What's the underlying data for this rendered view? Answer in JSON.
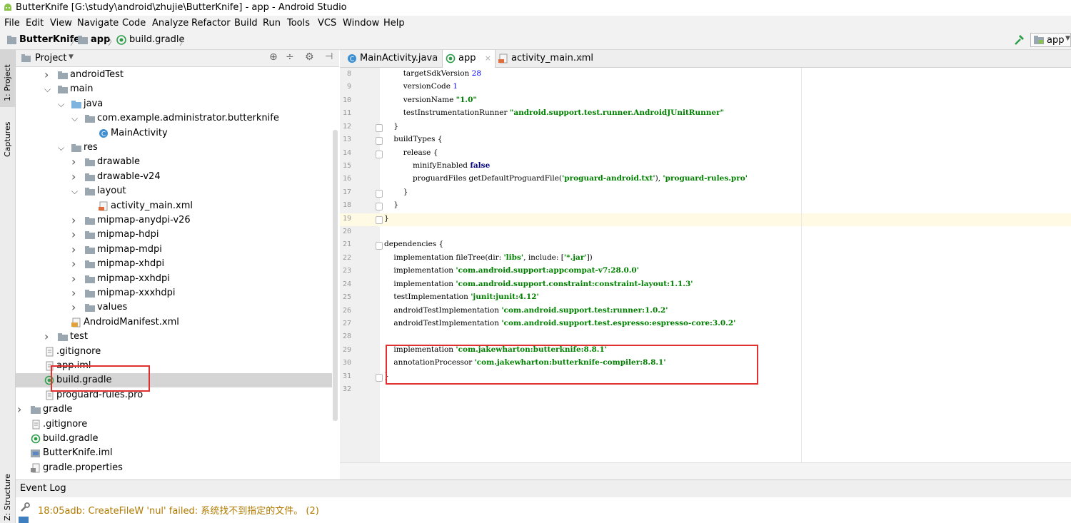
{
  "window": {
    "title": "ButterKnife [G:\\study\\android\\zhujie\\ButterKnife] - app - Android Studio"
  },
  "menu": [
    "File",
    "Edit",
    "View",
    "Navigate",
    "Code",
    "Analyze",
    "Refactor",
    "Build",
    "Run",
    "Tools",
    "VCS",
    "Window",
    "Help"
  ],
  "breadcrumb": {
    "project": "ButterKnife",
    "module": "app",
    "file": "build.gradle"
  },
  "run_config": {
    "label": "app"
  },
  "side_tabs": {
    "project": "1: Project",
    "captures": "Captures",
    "structure": "Z: Structure"
  },
  "project_panel": {
    "title": "Project",
    "tree": [
      {
        "label": "androidTest",
        "depth": 3,
        "arrow": "right",
        "icon": "folder"
      },
      {
        "label": "main",
        "depth": 3,
        "arrow": "down",
        "icon": "folder"
      },
      {
        "label": "java",
        "depth": 4,
        "arrow": "down",
        "icon": "folder-blue"
      },
      {
        "label": "com.example.administrator.butterknife",
        "depth": 5,
        "arrow": "down",
        "icon": "folder"
      },
      {
        "label": "MainActivity",
        "depth": 6,
        "arrow": "",
        "icon": "class"
      },
      {
        "label": "res",
        "depth": 4,
        "arrow": "down",
        "icon": "folder"
      },
      {
        "label": "drawable",
        "depth": 5,
        "arrow": "right",
        "icon": "folder"
      },
      {
        "label": "drawable-v24",
        "depth": 5,
        "arrow": "right",
        "icon": "folder"
      },
      {
        "label": "layout",
        "depth": 5,
        "arrow": "down",
        "icon": "folder"
      },
      {
        "label": "activity_main.xml",
        "depth": 6,
        "arrow": "",
        "icon": "xml"
      },
      {
        "label": "mipmap-anydpi-v26",
        "depth": 5,
        "arrow": "right",
        "icon": "folder"
      },
      {
        "label": "mipmap-hdpi",
        "depth": 5,
        "arrow": "right",
        "icon": "folder"
      },
      {
        "label": "mipmap-mdpi",
        "depth": 5,
        "arrow": "right",
        "icon": "folder"
      },
      {
        "label": "mipmap-xhdpi",
        "depth": 5,
        "arrow": "right",
        "icon": "folder"
      },
      {
        "label": "mipmap-xxhdpi",
        "depth": 5,
        "arrow": "right",
        "icon": "folder"
      },
      {
        "label": "mipmap-xxxhdpi",
        "depth": 5,
        "arrow": "right",
        "icon": "folder"
      },
      {
        "label": "values",
        "depth": 5,
        "arrow": "right",
        "icon": "folder"
      },
      {
        "label": "AndroidManifest.xml",
        "depth": 4,
        "arrow": "",
        "icon": "manifest"
      },
      {
        "label": "test",
        "depth": 3,
        "arrow": "right",
        "icon": "folder"
      },
      {
        "label": ".gitignore",
        "depth": 2,
        "arrow": "",
        "icon": "file"
      },
      {
        "label": "app.iml",
        "depth": 2,
        "arrow": "",
        "icon": "file"
      },
      {
        "label": "build.gradle",
        "depth": 2,
        "arrow": "",
        "icon": "gradle",
        "selected": true
      },
      {
        "label": "proguard-rules.pro",
        "depth": 2,
        "arrow": "",
        "icon": "file"
      },
      {
        "label": "gradle",
        "depth": 1,
        "arrow": "right",
        "icon": "folder"
      },
      {
        "label": ".gitignore",
        "depth": 1,
        "arrow": "",
        "icon": "file"
      },
      {
        "label": "build.gradle",
        "depth": 1,
        "arrow": "",
        "icon": "gradle"
      },
      {
        "label": "ButterKnife.iml",
        "depth": 1,
        "arrow": "",
        "icon": "iml"
      },
      {
        "label": "gradle.properties",
        "depth": 1,
        "arrow": "",
        "icon": "props"
      }
    ]
  },
  "editor_tabs": [
    {
      "label": "MainActivity.java",
      "icon": "class"
    },
    {
      "label": "app",
      "icon": "gradle",
      "active": true
    },
    {
      "label": "activity_main.xml",
      "icon": "xml"
    }
  ],
  "code_lines": [
    {
      "n": "8",
      "t": [
        [
          "        targetSdkVersion ",
          ""
        ],
        [
          "28",
          "num"
        ]
      ]
    },
    {
      "n": "9",
      "t": [
        [
          "        versionCode ",
          ""
        ],
        [
          "1",
          "num"
        ]
      ]
    },
    {
      "n": "10",
      "t": [
        [
          "        versionName ",
          ""
        ],
        [
          "\"1.0\"",
          "str"
        ]
      ]
    },
    {
      "n": "11",
      "t": [
        [
          "        testInstrumentationRunner ",
          ""
        ],
        [
          "\"android.support.test.runner.AndroidJUnitRunner\"",
          "str"
        ]
      ]
    },
    {
      "n": "12",
      "t": [
        [
          "    }",
          ""
        ]
      ]
    },
    {
      "n": "13",
      "t": [
        [
          "    buildTypes {",
          ""
        ]
      ]
    },
    {
      "n": "14",
      "t": [
        [
          "        release {",
          ""
        ]
      ]
    },
    {
      "n": "15",
      "t": [
        [
          "            minifyEnabled ",
          ""
        ],
        [
          "false",
          "kw"
        ]
      ]
    },
    {
      "n": "16",
      "t": [
        [
          "            proguardFiles getDefaultProguardFile(",
          ""
        ],
        [
          "'proguard-android.txt'",
          "str"
        ],
        [
          "), ",
          ""
        ],
        [
          "'proguard-rules.pro'",
          "str"
        ]
      ]
    },
    {
      "n": "17",
      "t": [
        [
          "        }",
          ""
        ]
      ]
    },
    {
      "n": "18",
      "t": [
        [
          "    }",
          ""
        ]
      ]
    },
    {
      "n": "19",
      "t": [
        [
          "}",
          ""
        ]
      ]
    },
    {
      "n": "20",
      "t": [
        [
          "",
          ""
        ]
      ]
    },
    {
      "n": "21",
      "t": [
        [
          "dependencies {",
          ""
        ]
      ]
    },
    {
      "n": "22",
      "t": [
        [
          "    implementation fileTree(dir: ",
          ""
        ],
        [
          "'libs'",
          "str"
        ],
        [
          ", include: [",
          ""
        ],
        [
          "'*.jar'",
          "str"
        ],
        [
          "])",
          ""
        ]
      ]
    },
    {
      "n": "23",
      "t": [
        [
          "    implementation ",
          ""
        ],
        [
          "'com.android.support:appcompat-v7:28.0.0'",
          "str"
        ]
      ]
    },
    {
      "n": "24",
      "t": [
        [
          "    implementation ",
          ""
        ],
        [
          "'com.android.support.constraint:constraint-layout:1.1.3'",
          "str"
        ]
      ]
    },
    {
      "n": "25",
      "t": [
        [
          "    testImplementation ",
          ""
        ],
        [
          "'junit:junit:4.12'",
          "str"
        ]
      ]
    },
    {
      "n": "26",
      "t": [
        [
          "    androidTestImplementation ",
          ""
        ],
        [
          "'com.android.support.test:runner:1.0.2'",
          "str"
        ]
      ]
    },
    {
      "n": "27",
      "t": [
        [
          "    androidTestImplementation ",
          ""
        ],
        [
          "'com.android.support.test.espresso:espresso-core:3.0.2'",
          "str"
        ]
      ]
    },
    {
      "n": "28",
      "t": [
        [
          "",
          ""
        ]
      ]
    },
    {
      "n": "29",
      "t": [
        [
          "    implementation ",
          ""
        ],
        [
          "'com.jakewharton:butterknife:8.8.1'",
          "str"
        ]
      ]
    },
    {
      "n": "30",
      "t": [
        [
          "    annotationProcessor ",
          ""
        ],
        [
          "'com.jakewharton:butterknife-compiler:8.8.1'",
          "str"
        ]
      ]
    },
    {
      "n": "31",
      "t": [
        [
          "}",
          ""
        ]
      ]
    },
    {
      "n": "32",
      "t": [
        [
          "",
          ""
        ]
      ]
    }
  ],
  "event_log": {
    "title": "Event Log",
    "message": "18:05adb: CreateFileW 'nul' failed: 系统找不到指定的文件。 (2)"
  },
  "colors": {
    "highlight_box": "#e03030",
    "log_text": "#b07a00"
  }
}
